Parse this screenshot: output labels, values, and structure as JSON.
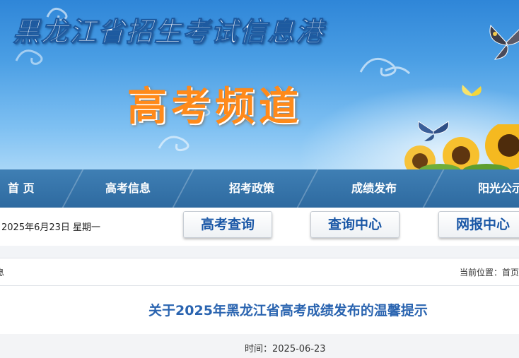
{
  "banner": {
    "site_title": "黑龙江省招生考试信息港",
    "channel_title": "高考频道"
  },
  "nav": {
    "items": [
      {
        "label": "首 页"
      },
      {
        "label": "高考信息"
      },
      {
        "label": "招考政策"
      },
      {
        "label": "成绩发布"
      },
      {
        "label": "阳光公示"
      }
    ]
  },
  "infobar": {
    "date": "2025年6月23日 星期一",
    "buttons": [
      {
        "label": "高考查询"
      },
      {
        "label": "查询中心"
      },
      {
        "label": "网报中心"
      }
    ]
  },
  "breadcrumb": {
    "left_text": "息",
    "location_label": "当前位置：",
    "home_link": "首页"
  },
  "article": {
    "title": "关于2025年黑龙江省高考成绩发布的温馨提示",
    "time_label": "时间：",
    "time_value": "2025-06-23"
  },
  "colors": {
    "nav_bg": "#2e6aa0",
    "title_blue": "#2a64b0",
    "channel_orange": "#ff8a1a",
    "button_text": "#1a57a6"
  }
}
